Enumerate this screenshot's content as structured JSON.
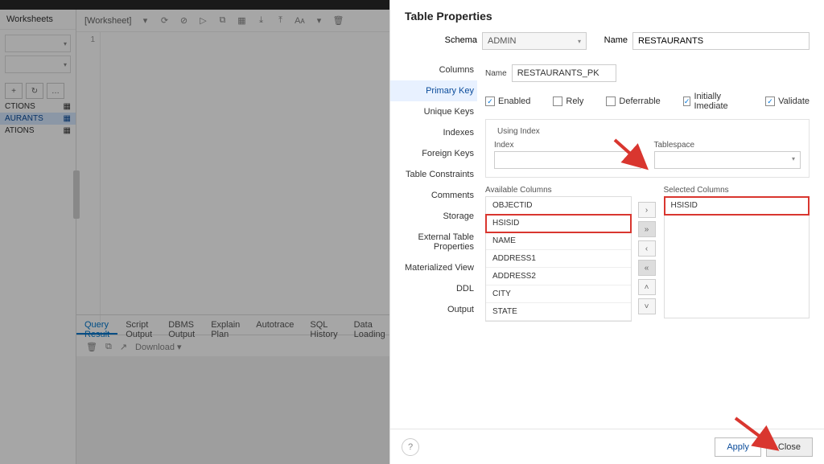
{
  "app": {
    "title_bar": ""
  },
  "sidebar": {
    "header": "Worksheets",
    "tools": [
      "+",
      "↻",
      "…"
    ],
    "tree": [
      {
        "label": "CTIONS",
        "selected": false
      },
      {
        "label": "AURANTS",
        "selected": true
      },
      {
        "label": "ATIONS",
        "selected": false
      }
    ]
  },
  "worksheet": {
    "tab_label": "[Worksheet]",
    "tools": [
      "▾",
      "⟳",
      "⊘",
      "▷",
      "⧉",
      "▦",
      "⤓",
      "⤒",
      "Aᴀ",
      "▾",
      "🗑"
    ],
    "gutter_first": "1"
  },
  "results": {
    "tabs": [
      "Query Result",
      "Script Output",
      "DBMS Output",
      "Explain Plan",
      "Autotrace",
      "SQL History",
      "Data Loading"
    ],
    "active_tab_index": 0,
    "tool_download": "Download"
  },
  "modal": {
    "title": "Table Properties",
    "nav": [
      "Columns",
      "Primary Key",
      "Unique Keys",
      "Indexes",
      "Foreign Keys",
      "Table Constraints",
      "Comments",
      "Storage",
      "External Table Properties",
      "Materialized View",
      "DDL",
      "Output"
    ],
    "nav_active_index": 1,
    "schema_label": "Schema",
    "schema_value": "ADMIN",
    "name_label": "Name",
    "name_value": "RESTAURANTS",
    "pk": {
      "name_label": "Name",
      "name_value": "RESTAURANTS_PK",
      "enabled_label": "Enabled",
      "rely_label": "Rely",
      "deferrable_label": "Deferrable",
      "initially_label": "Initially Imediate",
      "validate_label": "Validate",
      "using_index_legend": "Using Index",
      "index_label": "Index",
      "tablespace_label": "Tablespace",
      "available_header": "Available Columns",
      "selected_header": "Selected Columns",
      "available": [
        "OBJECTID",
        "HSISID",
        "NAME",
        "ADDRESS1",
        "ADDRESS2",
        "CITY",
        "STATE"
      ],
      "selected": [
        "HSISID"
      ]
    },
    "footer": {
      "help_glyph": "?",
      "apply": "Apply",
      "close": "Close"
    }
  }
}
